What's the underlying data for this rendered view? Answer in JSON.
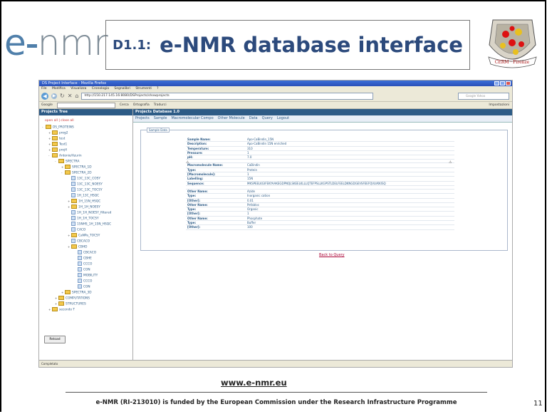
{
  "slide": {
    "logo": {
      "e": "e",
      "nmr": "nmr"
    },
    "code": "D1.1:",
    "title": "e-NMR database interface",
    "seal_text": "CERM · Firenze",
    "website": "www.e-nmr.eu",
    "footer": "e-NMR (RI-213010) is funded by the European Commission under the Research Infrastructure Programme",
    "page_number": "11"
  },
  "browser": {
    "window_title": "DS Project Interface - Mozilla Firefox",
    "menu": [
      "File",
      "Modifica",
      "Visualizza",
      "Cronologia",
      "Segnalibri",
      "Strumenti",
      "?"
    ],
    "url": "http://150.217.145.16:8080/DSProjects/showprojects",
    "search_placeholder": "Google Yahoo",
    "toolbar": [
      "Google",
      "Cerca",
      "Ortografia",
      "Tradurci",
      "Impostazioni"
    ],
    "status": "Completato",
    "colors": {
      "title_bar": "#3b6fd8",
      "chrome": "#ece9d8"
    }
  },
  "app": {
    "tree_title": "Projects Tree",
    "tree_links": "open all | close all",
    "tree": [
      {
        "t": "DS_PROTEINS",
        "d": 0,
        "k": "fold",
        "x": "-"
      },
      {
        "t": "prog2",
        "d": 1,
        "k": "fold",
        "x": "+"
      },
      {
        "t": "test",
        "d": 1,
        "k": "fold",
        "x": "+"
      },
      {
        "t": "Test1",
        "d": 1,
        "k": "fold",
        "x": "+"
      },
      {
        "t": "proj4",
        "d": 1,
        "k": "fold",
        "x": "+"
      },
      {
        "t": "Antonio/Azurin",
        "d": 1,
        "k": "fold",
        "x": "-"
      },
      {
        "t": "SPECTRA",
        "d": 2,
        "k": "fold",
        "x": "-"
      },
      {
        "t": "SPECTRA_1D",
        "d": 3,
        "k": "fold",
        "x": "+"
      },
      {
        "t": "SPECTRA_2D",
        "d": 3,
        "k": "fold",
        "x": "-"
      },
      {
        "t": "13C_13C_COSY",
        "d": 4,
        "k": "leaf",
        "x": ""
      },
      {
        "t": "13C_13C_NOESY",
        "d": 4,
        "k": "leaf",
        "x": ""
      },
      {
        "t": "13C_13C_TOCSY",
        "d": 4,
        "k": "leaf",
        "x": ""
      },
      {
        "t": "1H_13C_HSQC",
        "d": 4,
        "k": "leaf",
        "x": ""
      },
      {
        "t": "1H_15N_HSQC",
        "d": 4,
        "k": "fold",
        "x": "+"
      },
      {
        "t": "1H_1H_NOESY",
        "d": 4,
        "k": "fold",
        "x": "+"
      },
      {
        "t": "1H_1H_NOESY_filtered",
        "d": 4,
        "k": "leaf",
        "x": ""
      },
      {
        "t": "1H_1H_TOCSY",
        "d": 4,
        "k": "leaf",
        "x": ""
      },
      {
        "t": "15NHS_1H_15N_HSQC",
        "d": 4,
        "k": "leaf",
        "x": ""
      },
      {
        "t": "CACO",
        "d": 4,
        "k": "leaf",
        "x": ""
      },
      {
        "t": "CaNPa_TOCSY",
        "d": 4,
        "k": "fold",
        "x": "+"
      },
      {
        "t": "CBCACO",
        "d": 4,
        "k": "leaf",
        "x": ""
      },
      {
        "t": "CBHD",
        "d": 4,
        "k": "fold",
        "x": "+"
      },
      {
        "t": "CBCACO",
        "d": 5,
        "k": "leaf",
        "x": ""
      },
      {
        "t": "CBHE",
        "d": 5,
        "k": "leaf",
        "x": ""
      },
      {
        "t": "CCCO",
        "d": 5,
        "k": "leaf",
        "x": ""
      },
      {
        "t": "CON",
        "d": 5,
        "k": "leaf",
        "x": ""
      },
      {
        "t": "MOBILITY",
        "d": 5,
        "k": "leaf",
        "x": ""
      },
      {
        "t": "CCCO",
        "d": 5,
        "k": "leaf",
        "x": ""
      },
      {
        "t": "CON",
        "d": 5,
        "k": "leaf",
        "x": ""
      },
      {
        "t": "SPECTRA_3D",
        "d": 3,
        "k": "fold",
        "x": "+"
      },
      {
        "t": "COMPUTATIONS",
        "d": 2,
        "k": "fold",
        "x": "+"
      },
      {
        "t": "STRUCTURES",
        "d": 2,
        "k": "fold",
        "x": "+"
      },
      {
        "t": "secondo T",
        "d": 1,
        "k": "fold",
        "x": "+"
      }
    ],
    "reload_label": "Reload",
    "main_title": "Projects Database 1.0",
    "nav": [
      "Projects",
      "Sample",
      "Macromolecular Compo",
      "Other Molecule",
      "Data",
      "Query",
      "Logout"
    ],
    "fieldset_legend": "Sample Data",
    "rows": [
      {
        "k": "Sample Name:",
        "v": "Apo-CaBindin_15N"
      },
      {
        "k": "Description:",
        "v": "Apo-CaBindin 15N enriched"
      },
      {
        "k": "Temperature:",
        "v": "310"
      },
      {
        "k": "Pressure:",
        "v": "1"
      },
      {
        "k": "pH:",
        "v": "7.0"
      },
      {
        "k": "",
        "v": ""
      },
      {
        "k": "Macromolecule Name:",
        "v": "CaBindin"
      },
      {
        "k": "Type:",
        "v": "Protein"
      },
      {
        "k": "[Macromolecule]:",
        "v": "1"
      },
      {
        "k": "Labelling:",
        "v": "15N"
      },
      {
        "k": "Sequence:",
        "v": "MKSPEELKGIFEKYAAKEGDPNQLSKEELKLLLQTEFPSLLKGPSTLDELFEELDKNGDGEVSFEEFQVLVKKISQ"
      },
      {
        "k": "",
        "v": ""
      },
      {
        "k": "Other Name:",
        "v": "Azide"
      },
      {
        "k": "Type:",
        "v": "Inorganic cation"
      },
      {
        "k": "[Other]:",
        "v": "0.01"
      },
      {
        "k": "Other Name:",
        "v": "Pefabloc"
      },
      {
        "k": "Type:",
        "v": "Organic"
      },
      {
        "k": "[Other]:",
        "v": "1"
      },
      {
        "k": "Other Name:",
        "v": "Phosphate"
      },
      {
        "k": "Type:",
        "v": "Buffer"
      },
      {
        "k": "[Other]:",
        "v": "100"
      }
    ],
    "back_link": "Back to Query"
  }
}
